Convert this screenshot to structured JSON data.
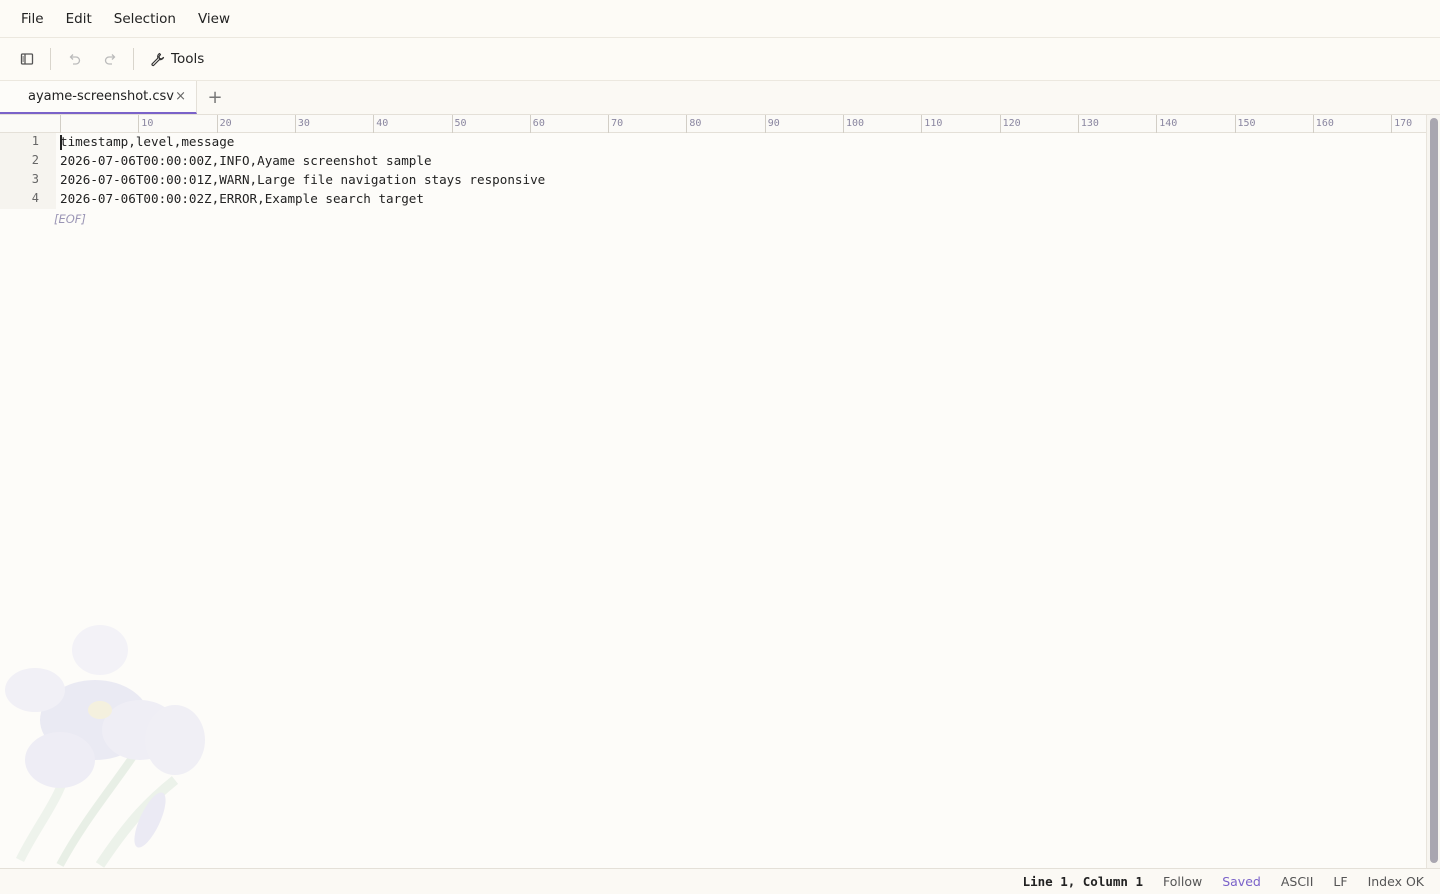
{
  "menubar": {
    "items": [
      {
        "label": "File"
      },
      {
        "label": "Edit"
      },
      {
        "label": "Selection"
      },
      {
        "label": "View"
      }
    ]
  },
  "toolbar": {
    "sidebar_icon": "sidebar-toggle-icon",
    "undo_icon": "undo-icon",
    "redo_icon": "redo-icon",
    "tools_label": "Tools",
    "tools_icon": "wrench-icon"
  },
  "tabs": [
    {
      "label": "ayame-screenshot.csv",
      "active": true
    }
  ],
  "tab_close_glyph": "×",
  "tab_add_glyph": "+",
  "ruler": {
    "labels": [
      "10",
      "20",
      "30",
      "40",
      "50",
      "60",
      "70",
      "80",
      "90",
      "100",
      "110",
      "120",
      "130",
      "140",
      "150",
      "160",
      "170"
    ]
  },
  "editor": {
    "lines": [
      {
        "num": "1",
        "text": "timestamp,level,message"
      },
      {
        "num": "2",
        "text": "2026-07-06T00:00:00Z,INFO,Ayame screenshot sample"
      },
      {
        "num": "3",
        "text": "2026-07-06T00:00:01Z,WARN,Large file navigation stays responsive"
      },
      {
        "num": "4",
        "text": "2026-07-06T00:00:02Z,ERROR,Example search target"
      }
    ],
    "eof_marker": "[EOF]"
  },
  "statusbar": {
    "position": "Line 1, Column 1",
    "follow": "Follow",
    "saved": "Saved",
    "encoding": "ASCII",
    "line_ending": "LF",
    "index": "Index OK"
  },
  "colors": {
    "accent": "#7a62c9",
    "background": "#fdfcf9"
  }
}
